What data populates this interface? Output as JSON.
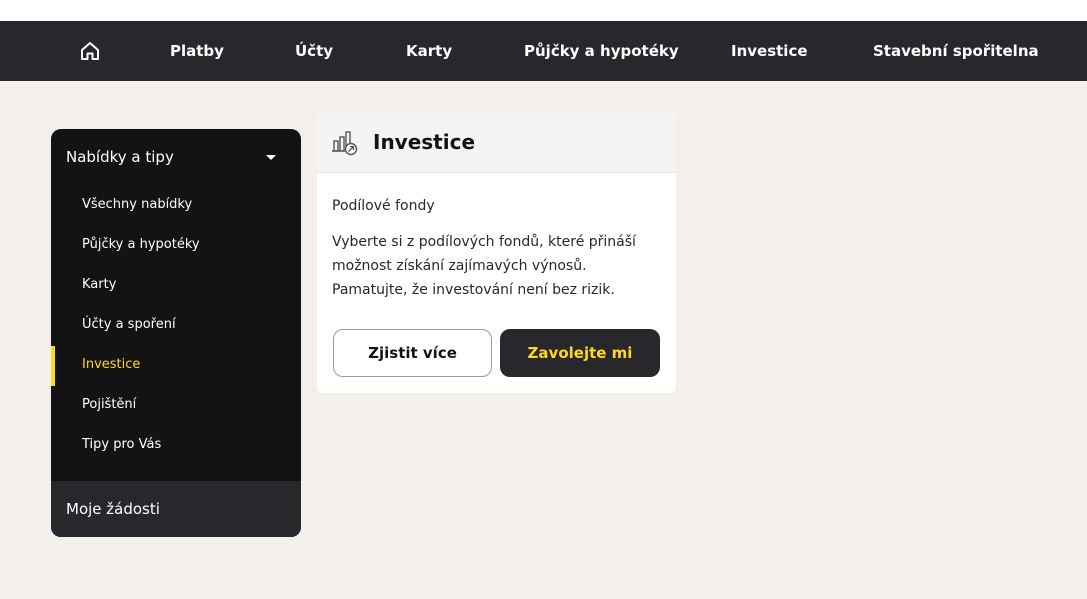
{
  "colors": {
    "page_bg": "#f3f0ec",
    "nav_bg": "#28282c",
    "sidebar_bg": "#131314",
    "accent": "#ffd91f"
  },
  "nav": {
    "home_icon": "home-icon",
    "items": [
      "Platby",
      "Účty",
      "Karty",
      "Půjčky a hypotéky",
      "Investice",
      "Stavební spořitelna"
    ]
  },
  "sidebar": {
    "header": "Nabídky a tipy",
    "header_icon": "chevron-down-icon",
    "items": [
      {
        "label": "Všechny nabídky",
        "active": false
      },
      {
        "label": "Půjčky a hypotéky",
        "active": false
      },
      {
        "label": "Karty",
        "active": false
      },
      {
        "label": "Účty a spoření",
        "active": false
      },
      {
        "label": "Investice",
        "active": true
      },
      {
        "label": "Pojištění",
        "active": false
      },
      {
        "label": "Tipy pro Vás",
        "active": false
      }
    ],
    "footer": "Moje žádosti"
  },
  "card": {
    "icon": "investment-chart-icon",
    "title": "Investice",
    "subtitle": "Podílové fondy",
    "text": "Vyberte si z podílových fondů, které přináší možnost získání zajímavých výnosů. Pamatujte, že investování není bez rizik.",
    "primary_button": "Zjistit více",
    "secondary_button": "Zavolejte mi"
  }
}
